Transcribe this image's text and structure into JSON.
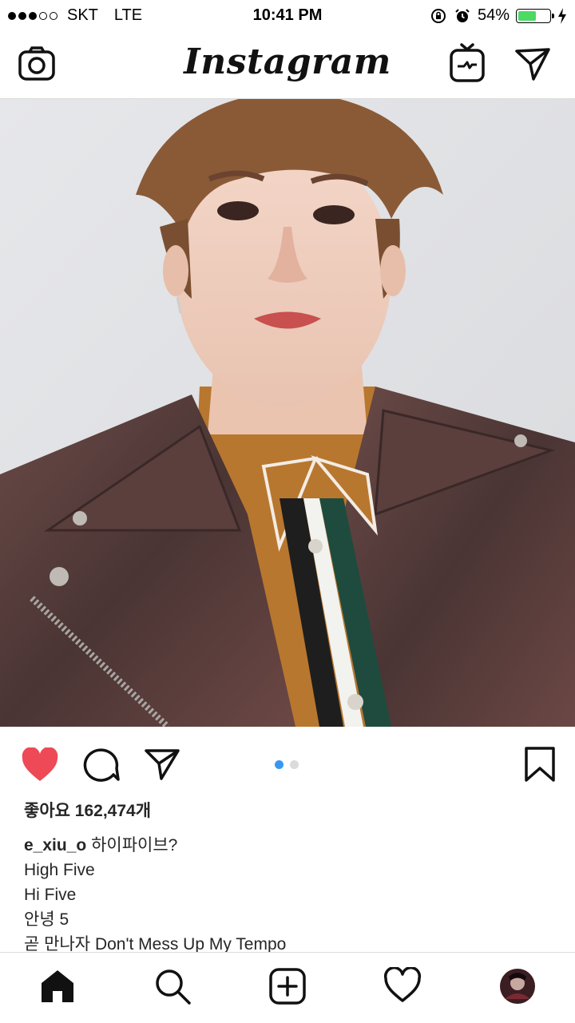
{
  "status_bar": {
    "carrier": "SKT",
    "network": "LTE",
    "time": "10:41 PM",
    "battery": "54%",
    "battery_level": 0.54,
    "signal_bars": 3,
    "signal_max": 5,
    "battery_color": "#4cd964"
  },
  "header": {
    "logo": "Instagram",
    "left_icon": "camera-icon",
    "right_icons": [
      "igtv-icon",
      "direct-message-icon"
    ]
  },
  "post": {
    "image_description_icon": "photo",
    "carousel": {
      "count": 2,
      "active": 1,
      "active_color": "#3897f0",
      "inactive_color": "#dbdbdb"
    },
    "liked": true,
    "like_color": "#ed4956",
    "likes_text": "좋아요 162,474개",
    "username": "e_xiu_o",
    "caption_lines": [
      "하이파이브?",
      "High Five",
      "Hi Five",
      "안녕 5",
      "곧 만나자 Don't Mess Up My Tempo"
    ]
  },
  "tabbar": {
    "items": [
      "home-icon",
      "search-icon",
      "new-post-icon",
      "activity-icon",
      "profile-avatar"
    ],
    "active": "home-icon"
  }
}
